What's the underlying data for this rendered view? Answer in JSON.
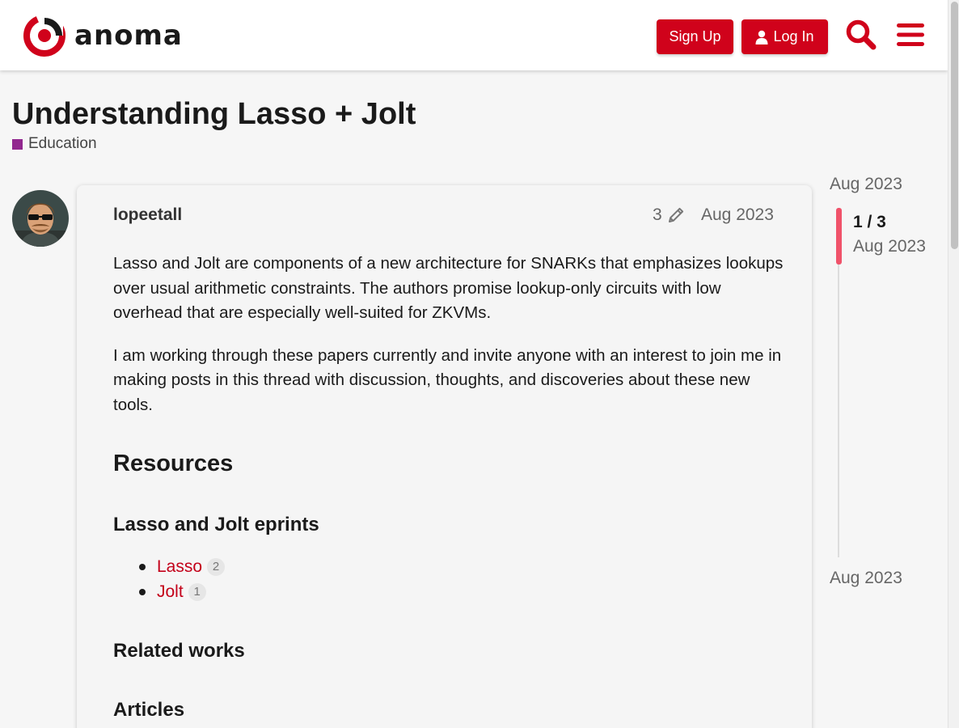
{
  "header": {
    "logo_text": "anoma",
    "signup_label": "Sign Up",
    "login_label": "Log In",
    "search_icon": "search-icon",
    "menu_icon": "hamburger-menu-icon"
  },
  "topic": {
    "title": "Understanding Lasso + Jolt",
    "category": "Education",
    "category_color": "#92278f"
  },
  "post": {
    "username": "lopeetall",
    "edit_count": "3",
    "date": "Aug 2023",
    "paragraphs": [
      "Lasso and Jolt are components of a new architecture for SNARKs that emphasizes lookups over usual arithmetic constraints. The authors promise lookup-only circuits with low overhead that are especially well-suited for ZKVMs.",
      "I am working through these papers currently and invite anyone with an interest to join me in making posts in this thread with discussion, thoughts, and discoveries about these new tools."
    ],
    "resources_heading": "Resources",
    "eprints_heading": "Lasso and Jolt eprints",
    "links": [
      {
        "text": "Lasso",
        "count": "2"
      },
      {
        "text": "Jolt",
        "count": "1"
      }
    ],
    "related_heading": "Related works",
    "articles_heading": "Articles"
  },
  "timeline": {
    "start_date": "Aug 2023",
    "position": "1 / 3",
    "position_date": "Aug 2023",
    "end_date": "Aug 2023"
  },
  "colors": {
    "brand": "#d0021b",
    "link": "#c30019",
    "timeline_handle": "#f0526a"
  }
}
